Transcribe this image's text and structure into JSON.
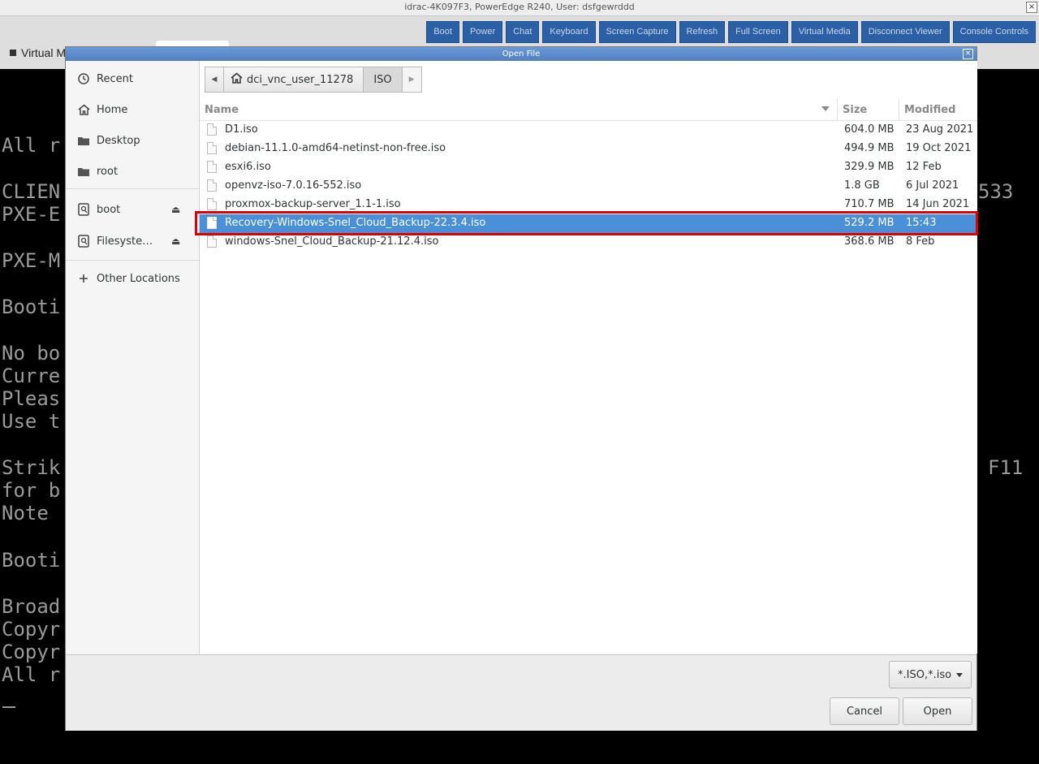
{
  "window": {
    "title": "idrac-4K097F3, PowerEdge R240, User: dsfgewrddd",
    "close": "×"
  },
  "viewer": {
    "toolbar": [
      "Boot",
      "Power",
      "Chat",
      "Keyboard",
      "Screen Capture",
      "Refresh",
      "Full Screen",
      "Virtual Media",
      "Disconnect Viewer",
      "Console Controls"
    ],
    "tab_label": "Virtual M"
  },
  "console": {
    "lines": [
      "All r",
      "",
      "CLIEN",
      "PXE-E",
      "",
      "PXE-M",
      "",
      "Booti",
      "",
      "No bo",
      "Curre",
      "Pleas",
      "Use t",
      "",
      "Strik",
      "for b",
      "Note",
      "",
      "Booti",
      "",
      "Broad",
      "Copyr",
      "Copyr",
      "All r"
    ],
    "right_top": "533",
    "right_mid": "F11"
  },
  "dialog": {
    "title": "Open File",
    "close": "×",
    "sidebar": {
      "items": [
        {
          "label": "Recent",
          "icon": "clock-icon"
        },
        {
          "label": "Home",
          "icon": "home-icon"
        },
        {
          "label": "Desktop",
          "icon": "folder-icon"
        },
        {
          "label": "root",
          "icon": "folder-icon"
        },
        {
          "label": "boot",
          "icon": "drive-icon",
          "eject": true
        },
        {
          "label": "Filesyste…",
          "icon": "drive-icon",
          "eject": true
        },
        {
          "label": "Other Locations",
          "icon": "plus-icon"
        }
      ]
    },
    "pathbar": {
      "home": "dci_vnc_user_11278",
      "current": "ISO"
    },
    "columns": {
      "name": "Name",
      "size": "Size",
      "modified": "Modified"
    },
    "files": [
      {
        "name": "D1.iso",
        "size": "604.0 MB",
        "modified": "23 Aug 2021",
        "selected": false
      },
      {
        "name": "debian-11.1.0-amd64-netinst-non-free.iso",
        "size": "494.9 MB",
        "modified": "19 Oct 2021",
        "selected": false
      },
      {
        "name": "esxi6.iso",
        "size": "329.9 MB",
        "modified": "12 Feb",
        "selected": false
      },
      {
        "name": "openvz-iso-7.0.16-552.iso",
        "size": "1.8 GB",
        "modified": "6 Jul 2021",
        "selected": false
      },
      {
        "name": "proxmox-backup-server_1.1-1.iso",
        "size": "710.7 MB",
        "modified": "14 Jun 2021",
        "selected": false
      },
      {
        "name": "Recovery-Windows-Snel_Cloud_Backup-22.3.4.iso",
        "size": "529.2 MB",
        "modified": "15:43",
        "selected": true
      },
      {
        "name": "windows-Snel_Cloud_Backup-21.12.4.iso",
        "size": "368.6 MB",
        "modified": "8 Feb",
        "selected": false
      }
    ],
    "filter": "*.ISO,*.iso",
    "buttons": {
      "cancel": "Cancel",
      "open": "Open"
    },
    "colors": {
      "selection": "#4a90d9",
      "highlight_box": "#e00000",
      "toolbar_button": "#2b5fa6"
    }
  }
}
